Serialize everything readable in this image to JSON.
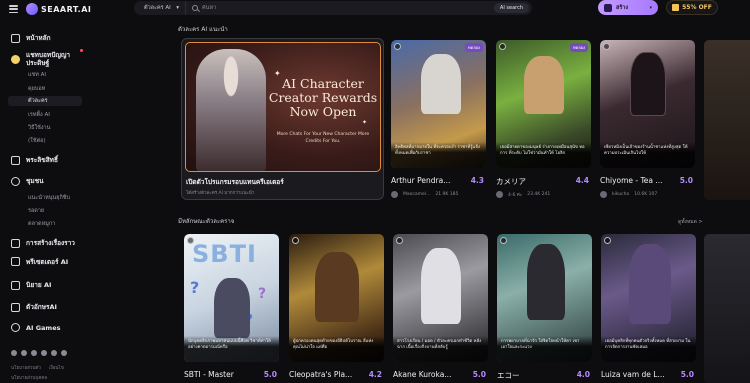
{
  "brand": {
    "name": "SEAART.AI"
  },
  "search": {
    "scope": "ตัวละคร AI",
    "placeholder": "ค้นหา",
    "ai_button": "AI search"
  },
  "header": {
    "create_label": "สร้าง",
    "offer_label": "55% OFF"
  },
  "sidebar": {
    "items": [
      {
        "label": "หน้าหลัก",
        "icon": "home-icon"
      },
      {
        "label": "แชทบอทปัญญาประดิษฐ์",
        "icon": "chat-icon"
      },
      {
        "label": "พระลิขสิทธิ์",
        "icon": "pen-icon"
      },
      {
        "label": "ชุมชน",
        "icon": "community-icon"
      },
      {
        "label": "การสร้างเรื่องราว",
        "icon": "story-icon"
      },
      {
        "label": "พรีเซตเตอร์ AI",
        "icon": "preset-icon"
      },
      {
        "label": "นิยาย AI",
        "icon": "book-icon"
      },
      {
        "label": "ตัวอักษรAI",
        "icon": "video-icon"
      },
      {
        "label": "AI Games",
        "icon": "game-icon"
      }
    ],
    "chat_subitems": [
      "แชท AI",
      "คุยบอท",
      "ตัวละคร",
      "เรทติ้ง AI",
      "วิธีใช้งาน",
      "(ใช้ต่อ)"
    ],
    "community_subitems": [
      "แนะนำหนุนยุกิชิบ",
      "รอดาย",
      "ตลาดหมูกา"
    ],
    "footer": [
      "นโยบายส่วนตัว",
      "เงื่อนไข",
      "นโยบายส่วนบุคคล"
    ]
  },
  "sections": {
    "top": {
      "title": "ตัวละคร AI แนะนำ"
    },
    "bottom": {
      "title": "มีหลักษณะตัวละคราจ",
      "see_all": "ดูทั้งหมด >"
    }
  },
  "featured": {
    "title": "AI Character Creator Rewards Now Open",
    "subtitle": "More Chats For Your New Character More Credits For You.",
    "caption": "เปิดตัวโปรแกรมรอบแทนครีเอเตอร์",
    "author": "ได้สร้างตัวละคร AI มากกว่าแนะนำ"
  },
  "cards_top": [
    {
      "name": "Arthur Pendra...",
      "rating": "4.3",
      "tag": "ทดลอง",
      "desc": "อิทธิพลที่มากมายใน ที่จะครอบงำ ราชาที่รู้แจ้งทั้งหมดเพื่อกับราชา",
      "author": "Maocamel...",
      "stats": "21.9K  185"
    },
    {
      "name": "カメリア",
      "rating": "4.4",
      "tag": "ทดลอง",
      "desc": "เธอมีสายตาของมนุษย์ ร่างกายเหมือนสุนัข ทอการ ที่ระดับ ไม่ใช่ว่ามันทำให้ โอลิก",
      "author": "4-6 ค่ะ",
      "stats": "23.4K  241"
    },
    {
      "name": "Chiyome - Tea ...",
      "rating": "5.0",
      "tag": "",
      "desc": "เซียวหมิงเป็นเจ้าของร้านน้ำชาแห่งที่สูงสุด ให้ความประเมินเกินไปให้",
      "author": "kikucho",
      "stats": "10.6K  107"
    }
  ],
  "cards_bottom": [
    {
      "name": "SBTI - Master",
      "rating": "5.0",
      "desc": "นักบุคคลิกภาพมหาคนแบบนี้คือพ วิชาที่ทำให้อย่างคาดอารมณ์หรือ"
    },
    {
      "name": "Cleopatra's Pla...",
      "rating": "4.2",
      "desc": "ผู้ปกครองคนสุดท้ายของอียิปต์โบราณ สีแห่งคุณไม่น่าใจ แต่คือ"
    },
    {
      "name": "Akane Kuroka...",
      "rating": "5.0",
      "desc": "สาวโรงเรียน / มอด / ตัวละครเอกทำชีวิต หลังฉาก เนื้อเรื่องกิ่งบานที่สลับรู้"
    },
    {
      "name": "エコー",
      "rating": "4.0",
      "desc": "การพยาบาลที่น่ารัก ใส่จิตใจหน้าให้ตา เขาเอาใจและระแวง"
    },
    {
      "name": "Luiza vam de L...",
      "rating": "5.0",
      "desc": "เธอมีบุคลิกที่ทุกคนตัวจริงทั้งหมด ที่สวยงาม ในการจัดการงานชัดเสมอ"
    }
  ],
  "colors": {
    "accent": "#b48cff",
    "featured_border": "#e08a3c",
    "offer": "#f4c45a"
  }
}
